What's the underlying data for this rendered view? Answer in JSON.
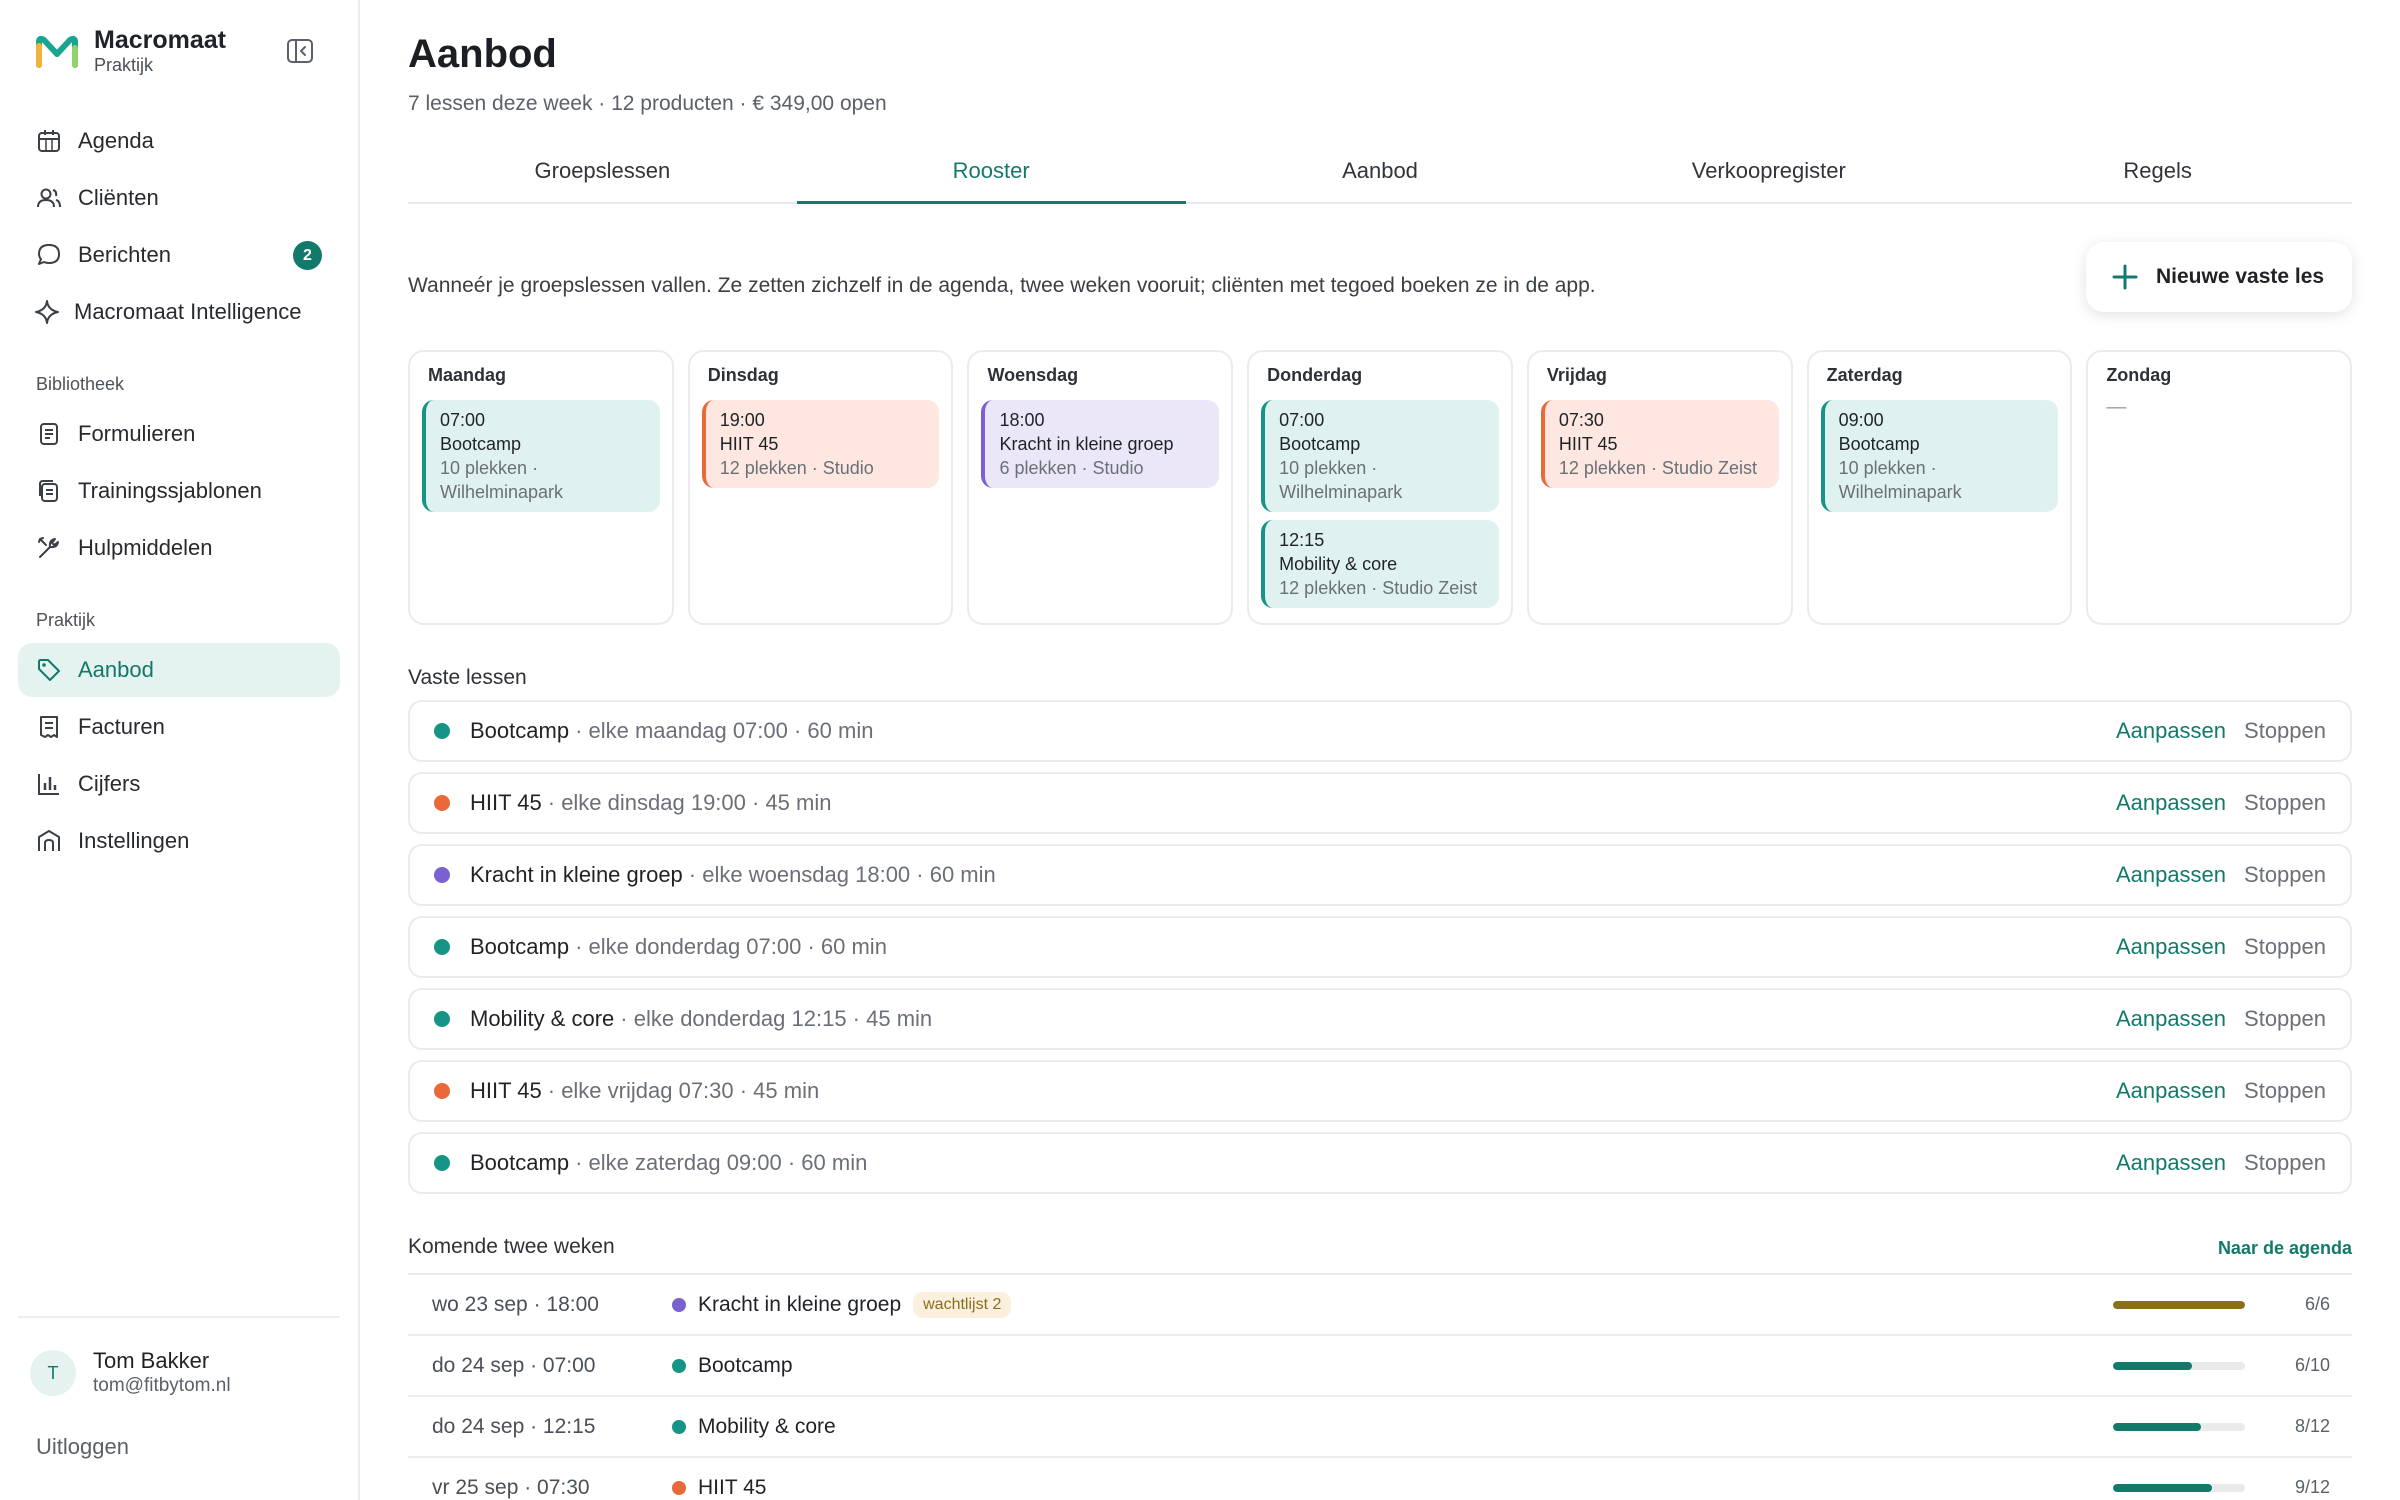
{
  "colors": {
    "accent": "#137a6b",
    "green": "#169485",
    "orange": "#e86a3a",
    "purple": "#7b61cf",
    "full": "#8a6d1d"
  },
  "brand": {
    "name": "Macromaat",
    "sub": "Praktijk"
  },
  "nav": {
    "main": [
      {
        "label": "Agenda",
        "icon": "calendar-icon"
      },
      {
        "label": "Cliënten",
        "icon": "users-icon"
      },
      {
        "label": "Berichten",
        "icon": "chat-icon",
        "badge": "2"
      },
      {
        "label": "Macromaat Intelligence",
        "icon": "sparkle-icon"
      }
    ],
    "library_title": "Bibliotheek",
    "library": [
      {
        "label": "Formulieren",
        "icon": "form-icon"
      },
      {
        "label": "Trainingssjablonen",
        "icon": "template-icon"
      },
      {
        "label": "Hulpmiddelen",
        "icon": "tools-icon"
      }
    ],
    "practice_title": "Praktijk",
    "practice": [
      {
        "label": "Aanbod",
        "icon": "tag-icon",
        "active": true
      },
      {
        "label": "Facturen",
        "icon": "invoice-icon"
      },
      {
        "label": "Cijfers",
        "icon": "chart-icon"
      },
      {
        "label": "Instellingen",
        "icon": "building-icon"
      }
    ]
  },
  "user": {
    "initial": "T",
    "name": "Tom Bakker",
    "email": "tom@fitbytom.nl",
    "logout": "Uitloggen"
  },
  "header": {
    "title": "Aanbod",
    "subtitle": "7 lessen deze week · 12 producten · € 349,00 open"
  },
  "tabs": [
    {
      "label": "Groepslessen"
    },
    {
      "label": "Rooster",
      "active": true
    },
    {
      "label": "Aanbod"
    },
    {
      "label": "Verkoopregister"
    },
    {
      "label": "Regels"
    }
  ],
  "schedule": {
    "intro": "Wanneér je groepslessen vallen. Ze zetten zichzelf in de agenda, twee weken vooruit; cliënten met tegoed boeken ze in de app.",
    "new_button": "Nieuwe vaste les",
    "empty": "—",
    "days": [
      {
        "name": "Maandag",
        "events": [
          {
            "time": "07:00",
            "title": "Bootcamp",
            "meta": "10 plekken · Wilhelminapark",
            "color": "green"
          }
        ]
      },
      {
        "name": "Dinsdag",
        "events": [
          {
            "time": "19:00",
            "title": "HIIT 45",
            "meta": "12 plekken · Studio",
            "color": "orange"
          }
        ]
      },
      {
        "name": "Woensdag",
        "events": [
          {
            "time": "18:00",
            "title": "Kracht in kleine groep",
            "meta": "6 plekken · Studio",
            "color": "purple"
          }
        ]
      },
      {
        "name": "Donderdag",
        "events": [
          {
            "time": "07:00",
            "title": "Bootcamp",
            "meta": "10 plekken · Wilhelminapark",
            "color": "green"
          },
          {
            "time": "12:15",
            "title": "Mobility & core",
            "meta": "12 plekken · Studio Zeist",
            "color": "green"
          }
        ]
      },
      {
        "name": "Vrijdag",
        "events": [
          {
            "time": "07:30",
            "title": "HIIT 45",
            "meta": "12 plekken · Studio Zeist",
            "color": "orange"
          }
        ]
      },
      {
        "name": "Zaterdag",
        "events": [
          {
            "time": "09:00",
            "title": "Bootcamp",
            "meta": "10 plekken · Wilhelminapark",
            "color": "green"
          }
        ]
      },
      {
        "name": "Zondag",
        "events": []
      }
    ]
  },
  "fixed": {
    "title": "Vaste lessen",
    "edit_label": "Aanpassen",
    "stop_label": "Stoppen",
    "items": [
      {
        "name": "Bootcamp",
        "detail": "· elke maandag 07:00 · 60 min",
        "color": "green"
      },
      {
        "name": "HIIT 45",
        "detail": "· elke dinsdag 19:00 · 45 min",
        "color": "orange"
      },
      {
        "name": "Kracht in kleine groep",
        "detail": "· elke woensdag 18:00 · 60 min",
        "color": "purple"
      },
      {
        "name": "Bootcamp",
        "detail": "· elke donderdag 07:00 · 60 min",
        "color": "green"
      },
      {
        "name": "Mobility & core",
        "detail": "· elke donderdag 12:15 · 45 min",
        "color": "green"
      },
      {
        "name": "HIIT 45",
        "detail": "· elke vrijdag 07:30 · 45 min",
        "color": "orange"
      },
      {
        "name": "Bootcamp",
        "detail": "· elke zaterdag 09:00 · 60 min",
        "color": "green"
      }
    ]
  },
  "upcoming": {
    "title": "Komende twee weken",
    "link": "Naar de agenda",
    "items": [
      {
        "date": "wo 23 sep · 18:00",
        "name": "Kracht in kleine groep",
        "badge": "wachtlijst 2",
        "count": "6/6",
        "fill": 1.0,
        "color": "purple",
        "bar": "full"
      },
      {
        "date": "do 24 sep · 07:00",
        "name": "Bootcamp",
        "count": "6/10",
        "fill": 0.6,
        "color": "green",
        "bar": "accent"
      },
      {
        "date": "do 24 sep · 12:15",
        "name": "Mobility & core",
        "count": "8/12",
        "fill": 0.667,
        "color": "green",
        "bar": "accent"
      },
      {
        "date": "vr 25 sep · 07:30",
        "name": "HIIT 45",
        "count": "9/12",
        "fill": 0.75,
        "color": "orange",
        "bar": "accent"
      }
    ]
  }
}
